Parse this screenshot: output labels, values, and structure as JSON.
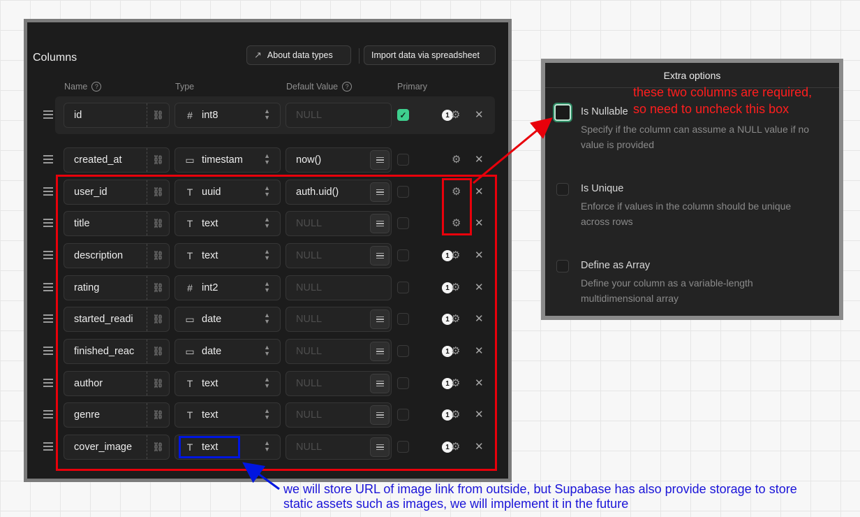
{
  "columns_panel": {
    "title": "Columns",
    "about_button": "About data types",
    "import_button": "Import data via spreadsheet",
    "headers": {
      "name": "Name",
      "type": "Type",
      "default": "Default Value",
      "primary": "Primary"
    },
    "rows": [
      {
        "name": "id",
        "type": "int8",
        "type_icon": "hash-icon",
        "default": "NULL",
        "default_is_null": true,
        "primary": true,
        "badge": "1"
      },
      {
        "name": "created_at",
        "type": "timestam",
        "type_icon": "calendar-icon",
        "default": "now()",
        "default_is_null": false,
        "primary": false,
        "badge": ""
      },
      {
        "name": "user_id",
        "type": "uuid",
        "type_icon": "text-t-icon",
        "default": "auth.uid()",
        "default_is_null": false,
        "primary": false,
        "badge": ""
      },
      {
        "name": "title",
        "type": "text",
        "type_icon": "text-t-icon",
        "default": "NULL",
        "default_is_null": true,
        "primary": false,
        "badge": ""
      },
      {
        "name": "description",
        "type": "text",
        "type_icon": "text-t-icon",
        "default": "NULL",
        "default_is_null": true,
        "primary": false,
        "badge": "1"
      },
      {
        "name": "rating",
        "type": "int2",
        "type_icon": "hash-icon",
        "default": "NULL",
        "default_is_null": true,
        "primary": false,
        "badge": "1"
      },
      {
        "name": "started_readi",
        "type": "date",
        "type_icon": "calendar-icon",
        "default": "NULL",
        "default_is_null": true,
        "primary": false,
        "badge": "1"
      },
      {
        "name": "finished_reac",
        "type": "date",
        "type_icon": "calendar-icon",
        "default": "NULL",
        "default_is_null": true,
        "primary": false,
        "badge": "1"
      },
      {
        "name": "author",
        "type": "text",
        "type_icon": "text-t-icon",
        "default": "NULL",
        "default_is_null": true,
        "primary": false,
        "badge": "1"
      },
      {
        "name": "genre",
        "type": "text",
        "type_icon": "text-t-icon",
        "default": "NULL",
        "default_is_null": true,
        "primary": false,
        "badge": "1"
      },
      {
        "name": "cover_image",
        "type": "text",
        "type_icon": "text-t-icon",
        "default": "NULL",
        "default_is_null": true,
        "primary": false,
        "badge": "1"
      }
    ]
  },
  "extra_options": {
    "title": "Extra options",
    "options": [
      {
        "title": "Is Nullable",
        "desc": "Specify if the column can assume a NULL value if no value is provided",
        "checked": false
      },
      {
        "title": "Is Unique",
        "desc": "Enforce if values in the column should be unique across rows",
        "checked": false
      },
      {
        "title": "Define as Array",
        "desc": "Define your column as a variable-length multidimensional array",
        "checked": false
      }
    ]
  },
  "annotations": {
    "red_note_line1": "these two columns are required,",
    "red_note_line2": "so need to uncheck this box",
    "blue_note": "we will store URL of image link from outside, but Supabase has also provide storage to store static assets such as images, we will implement it in the future"
  },
  "colors": {
    "accent_green": "#3ecf8e",
    "annotation_red": "#e8000b",
    "annotation_blue": "#0016e0"
  }
}
